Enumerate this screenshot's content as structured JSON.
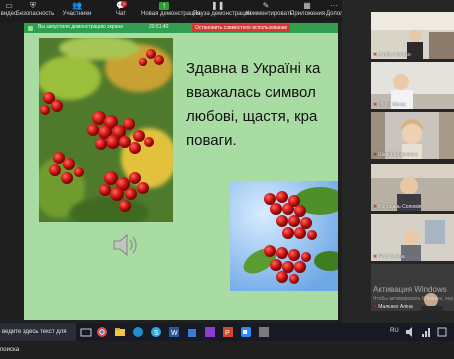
{
  "toolbar": {
    "items": [
      {
        "label": "видео",
        "icon": "video-icon"
      },
      {
        "label": "Безопасность",
        "icon": "shield-icon"
      },
      {
        "label": "Участники",
        "icon": "participants-icon",
        "count": "2"
      },
      {
        "label": "Чат",
        "icon": "chat-icon"
      },
      {
        "label": "Новая демонстрация",
        "icon": "share-screen-icon"
      },
      {
        "label": "Пауза демонстрации",
        "icon": "pause-icon"
      },
      {
        "label": "Комментировать",
        "icon": "annotate-icon"
      },
      {
        "label": "Приложения",
        "icon": "apps-icon"
      },
      {
        "label": "Допол",
        "icon": "more-icon"
      }
    ]
  },
  "share_banner": {
    "text": "Вы запустили демонстрацию экрана",
    "meeting_id": "20:51:40",
    "stop_label": "Остановить совместное использование"
  },
  "slide": {
    "lines": [
      "Здавна в Україні ка",
      "вважалась символ",
      "любові, щастя, кра",
      "поваги."
    ]
  },
  "participants": [
    {
      "name": "Andriy Usenko",
      "muted": true
    },
    {
      "name": "Daniil Moroz",
      "muted": true
    },
    {
      "name": "Шарій Кравченко",
      "muted": true
    },
    {
      "name": "Бородань Соломія",
      "muted": true
    },
    {
      "name": "iPad Олена",
      "muted": true
    },
    {
      "name": "Малєнко Аліна",
      "muted": true
    }
  ],
  "watermark": {
    "title": "Активация Windows",
    "subtitle": "Чтобы активировать Windows, перейдите в раздел \"Парам..."
  },
  "taskbar": {
    "search_placeholder": "ведите здесь текст для поиска",
    "lang": "RU",
    "colors": {
      "bg": "#171a24"
    }
  },
  "colors": {
    "slide_bg": "#a9dca3",
    "share_green": "#2f9e4f",
    "stop_red": "#d8362f"
  }
}
